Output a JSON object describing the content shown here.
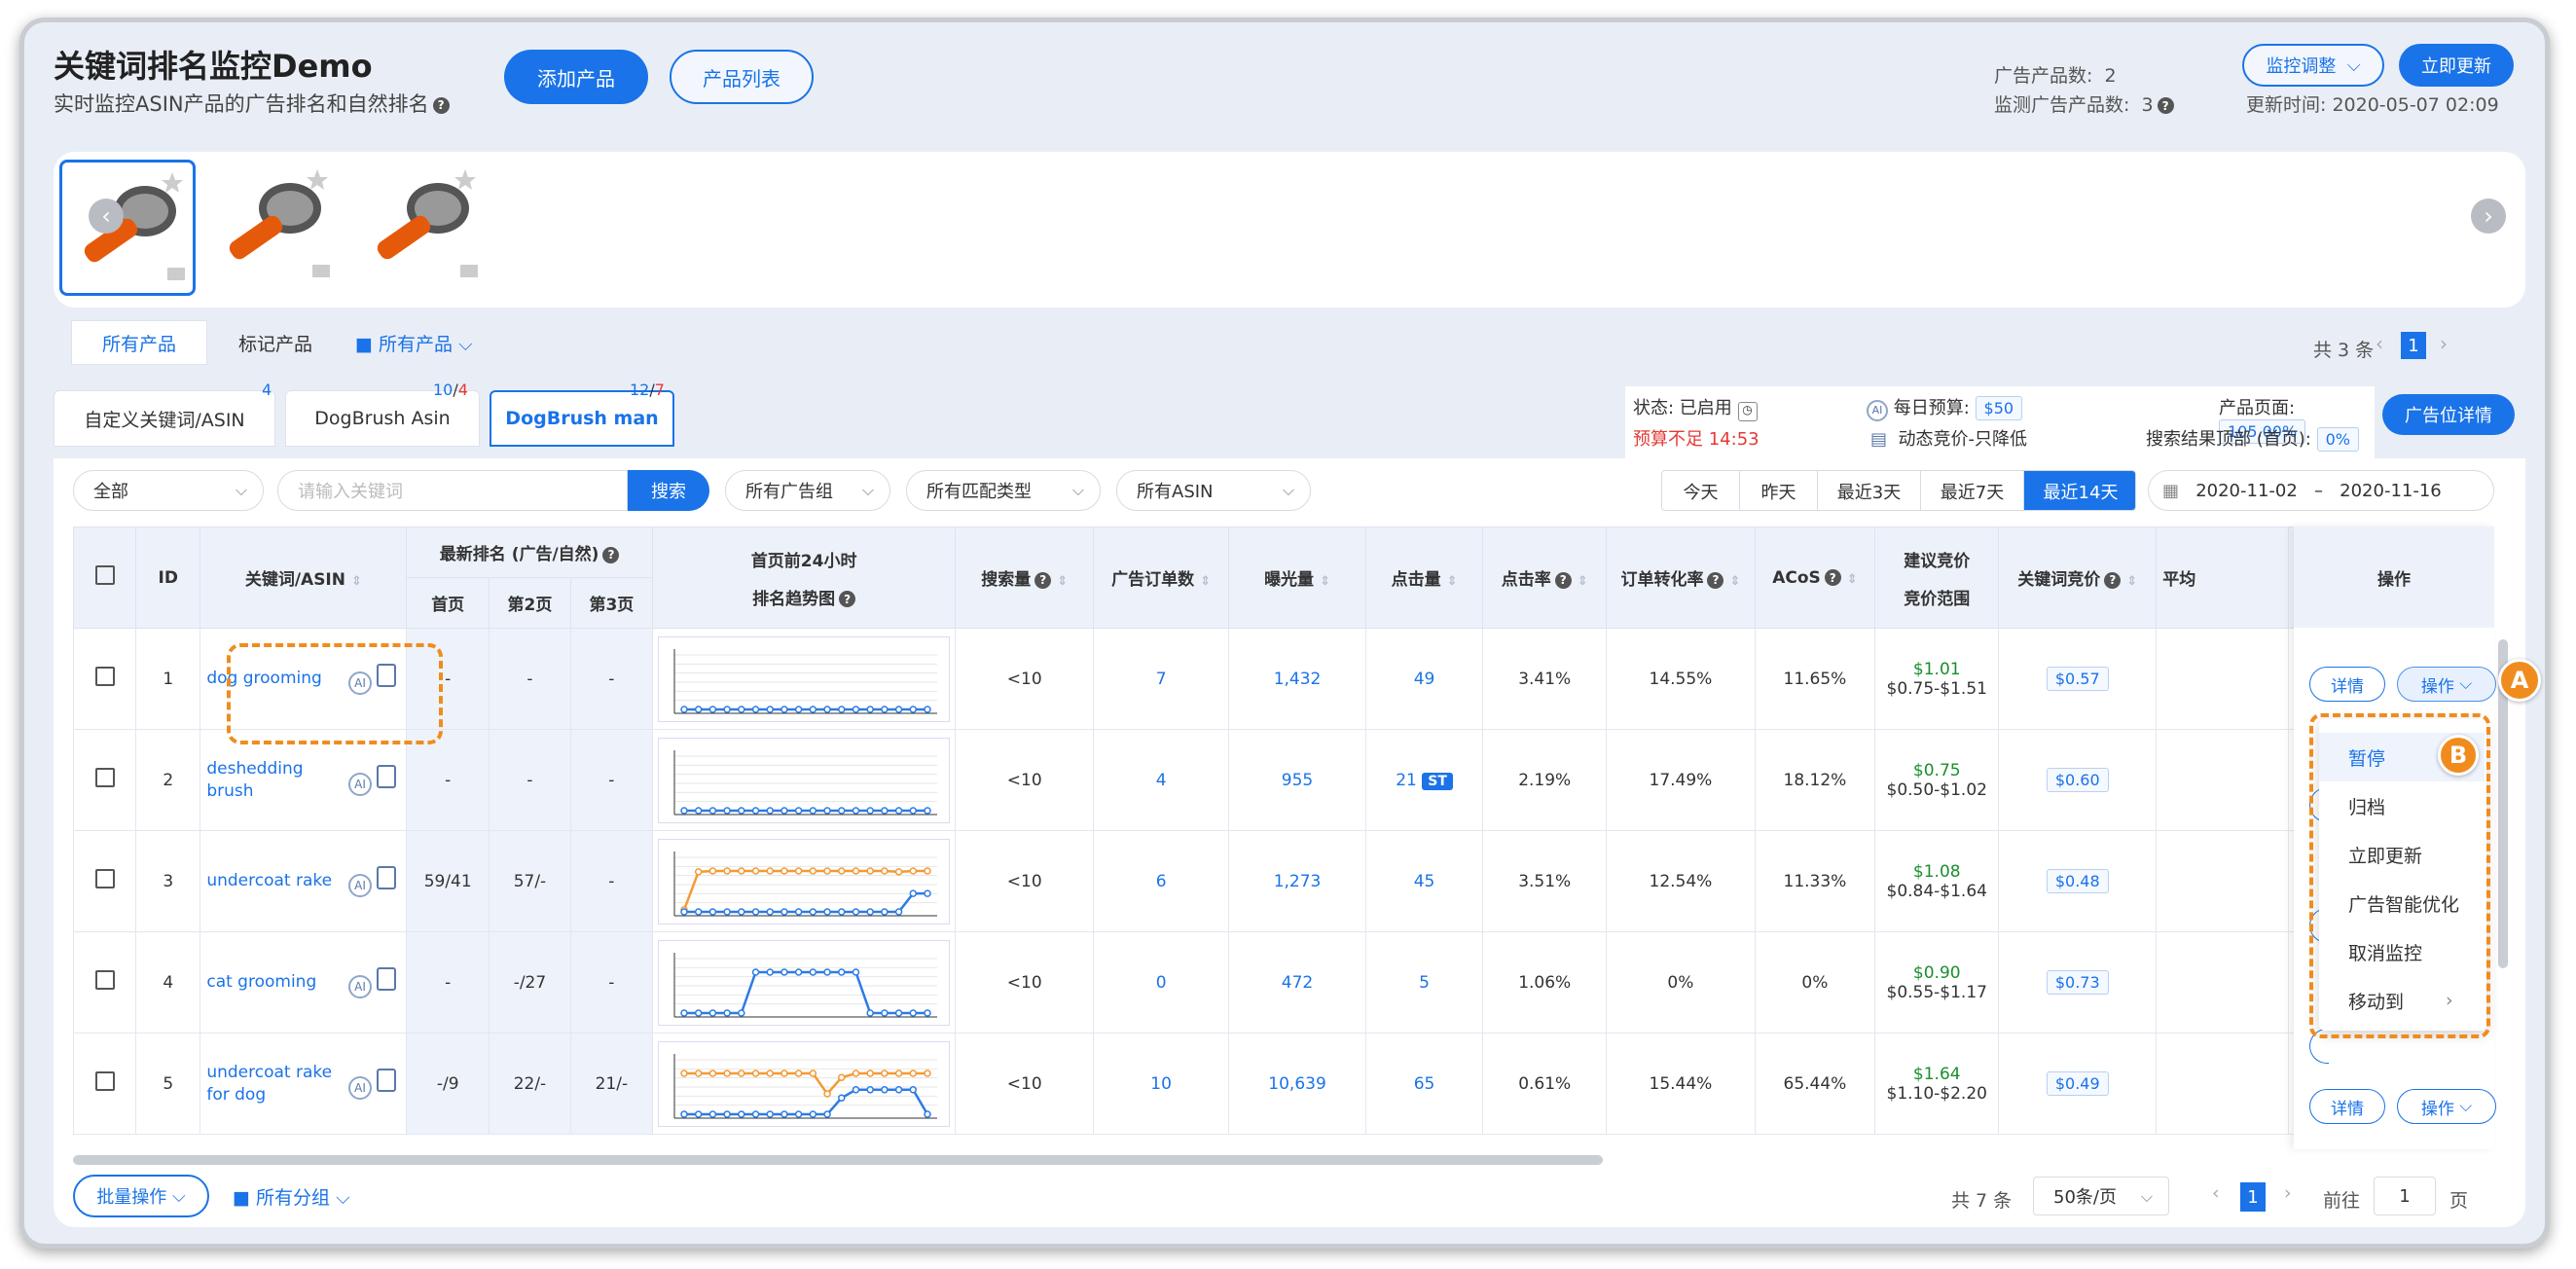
{
  "header": {
    "title": "关键词排名监控Demo",
    "subtitle": "实时监控ASIN产品的广告排名和自然排名",
    "add_product": "添加产品",
    "product_list": "产品列表",
    "ad_count_label": "广告产品数:",
    "ad_count": "2",
    "monitor_count_label": "监测广告产品数:",
    "monitor_count": "3",
    "monitor_adjust": "监控调整",
    "update_now": "立即更新",
    "update_time": "更新时间: 2020-05-07 02:09"
  },
  "filters": {
    "all_products": "所有产品",
    "marked_products": "标记产品",
    "folder_all": "所有产品",
    "total": "共 3 条",
    "page": "1"
  },
  "tabs": [
    {
      "label": "自定义关键词/ASIN",
      "badge": "4"
    },
    {
      "label": "DogBrush Asin",
      "badge_a": "10",
      "badge_b": "4"
    },
    {
      "label": "DogBrush man",
      "badge_a": "12",
      "badge_b": "7"
    }
  ],
  "status": {
    "state": "状态: 已启用",
    "budget_low": "预算不足 14:53",
    "budget_label": "每日预算:",
    "budget": "$50",
    "dynamic": "动态竞价-只降低",
    "page_label": "产品页面:",
    "page_pct": "105.00%",
    "top_label": "搜索结果顶部 (首页):",
    "top_pct": "0%",
    "ad_detail": "广告位详情"
  },
  "toolbar": {
    "all": "全部",
    "kw_placeholder": "请输入关键词",
    "search": "搜索",
    "ad_group": "所有广告组",
    "match_type": "所有匹配类型",
    "asin": "所有ASIN",
    "ranges": [
      "今天",
      "昨天",
      "最近3天",
      "最近7天",
      "最近14天"
    ],
    "date_from": "2020-11-02",
    "date_sep": "–",
    "date_to": "2020-11-16"
  },
  "columns": {
    "id": "ID",
    "kw": "关键词/ASIN",
    "rank": "最新排名 (广告/自然)",
    "p1": "首页",
    "p2": "第2页",
    "p3": "第3页",
    "trend": "首页前24小时",
    "trend2": "排名趋势图",
    "search": "搜索量",
    "orders": "广告订单数",
    "impr": "曝光量",
    "clicks": "点击量",
    "ctr": "点击率",
    "cvr": "订单转化率",
    "acos": "ACoS",
    "sugg": "建议竞价",
    "sugg2": "竞价范围",
    "bid": "关键词竞价",
    "avg": "平均",
    "ops": "操作"
  },
  "rows": [
    {
      "id": "1",
      "kw": "dog grooming",
      "p1": "-",
      "p2": "-",
      "p3": "-",
      "search": "<10",
      "orders": "7",
      "impr": "1,432",
      "clicks": "49",
      "ctr": "3.41%",
      "cvr": "14.55%",
      "acos": "11.65%",
      "sugg": "$1.01",
      "range": "$0.75-$1.51",
      "bid": "$0.57",
      "tag": ""
    },
    {
      "id": "2",
      "kw": "deshedding brush",
      "p1": "-",
      "p2": "-",
      "p3": "-",
      "search": "<10",
      "orders": "4",
      "impr": "955",
      "clicks": "21",
      "ctr": "2.19%",
      "cvr": "17.49%",
      "acos": "18.12%",
      "sugg": "$0.75",
      "range": "$0.50-$1.02",
      "bid": "$0.60",
      "tag": "ST"
    },
    {
      "id": "3",
      "kw": "undercoat rake",
      "p1": "59/41",
      "p2": "57/-",
      "p3": "-",
      "search": "<10",
      "orders": "6",
      "impr": "1,273",
      "clicks": "45",
      "ctr": "3.51%",
      "cvr": "12.54%",
      "acos": "11.33%",
      "sugg": "$1.08",
      "range": "$0.84-$1.64",
      "bid": "$0.48",
      "tag": ""
    },
    {
      "id": "4",
      "kw": "cat grooming",
      "p1": "-",
      "p2": "-/27",
      "p3": "-",
      "search": "<10",
      "orders": "0",
      "impr": "472",
      "clicks": "5",
      "ctr": "1.06%",
      "cvr": "0%",
      "acos": "0%",
      "sugg": "$0.90",
      "range": "$0.55-$1.17",
      "bid": "$0.73",
      "tag": ""
    },
    {
      "id": "5",
      "kw": "undercoat rake for dog",
      "p1": "-/9",
      "p2": "22/-",
      "p3": "21/-",
      "search": "<10",
      "orders": "10",
      "impr": "10,639",
      "clicks": "65",
      "ctr": "0.61%",
      "cvr": "15.44%",
      "acos": "65.44%",
      "sugg": "$1.64",
      "range": "$1.10-$2.20",
      "bid": "$0.49",
      "tag": ""
    }
  ],
  "row_actions": {
    "detail": "详情",
    "ops": "操作"
  },
  "menu": [
    "暂停",
    "归档",
    "立即更新",
    "广告智能优化",
    "取消监控",
    "移动到"
  ],
  "markers": {
    "a": "A",
    "b": "B"
  },
  "footer": {
    "batch": "批量操作",
    "groups": "所有分组",
    "total": "共 7 条",
    "per_page": "50条/页",
    "page": "1",
    "goto": "前往",
    "goto_val": "1",
    "page_unit": "页"
  },
  "colors": {
    "primary": "#1a73e8",
    "highlight": "#f08c1e",
    "trend_blue": "#2c7be5",
    "trend_orange": "#f39a33",
    "green": "#1a8f2e",
    "red": "#e53935"
  }
}
